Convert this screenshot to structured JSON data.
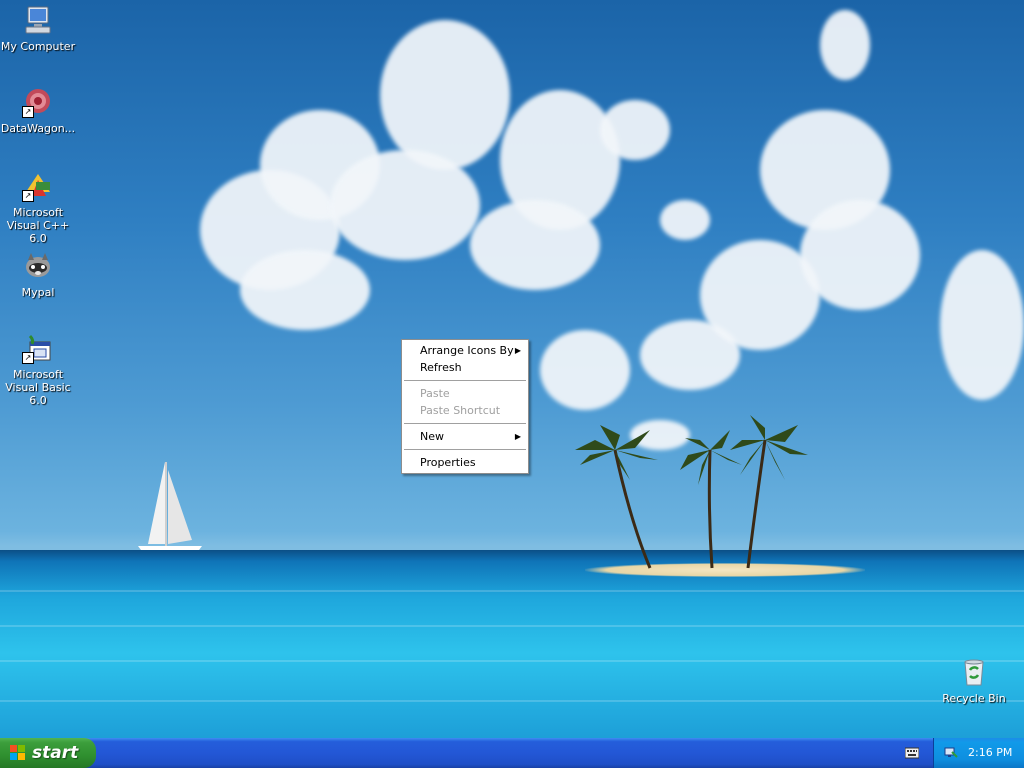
{
  "desktop": {
    "icons": [
      {
        "label": "My Computer"
      },
      {
        "label": "DataWagon..."
      },
      {
        "label": "Microsoft Visual C++ 6.0"
      },
      {
        "label": "Mypal"
      },
      {
        "label": "Microsoft Visual Basic 6.0"
      },
      {
        "label": "Recycle Bin"
      }
    ]
  },
  "context_menu": {
    "items": [
      {
        "label": "Arrange Icons By",
        "submenu": true,
        "enabled": true
      },
      {
        "label": "Refresh",
        "submenu": false,
        "enabled": true
      },
      {
        "label": "Paste",
        "submenu": false,
        "enabled": false
      },
      {
        "label": "Paste Shortcut",
        "submenu": false,
        "enabled": false
      },
      {
        "label": "New",
        "submenu": true,
        "enabled": true
      },
      {
        "label": "Properties",
        "submenu": false,
        "enabled": true
      }
    ]
  },
  "taskbar": {
    "start_label": "start",
    "clock": "2:16 PM"
  },
  "colors": {
    "taskbar_blue": "#245edb",
    "start_green": "#3c9e3c",
    "tray_blue": "#0e8fe0"
  }
}
